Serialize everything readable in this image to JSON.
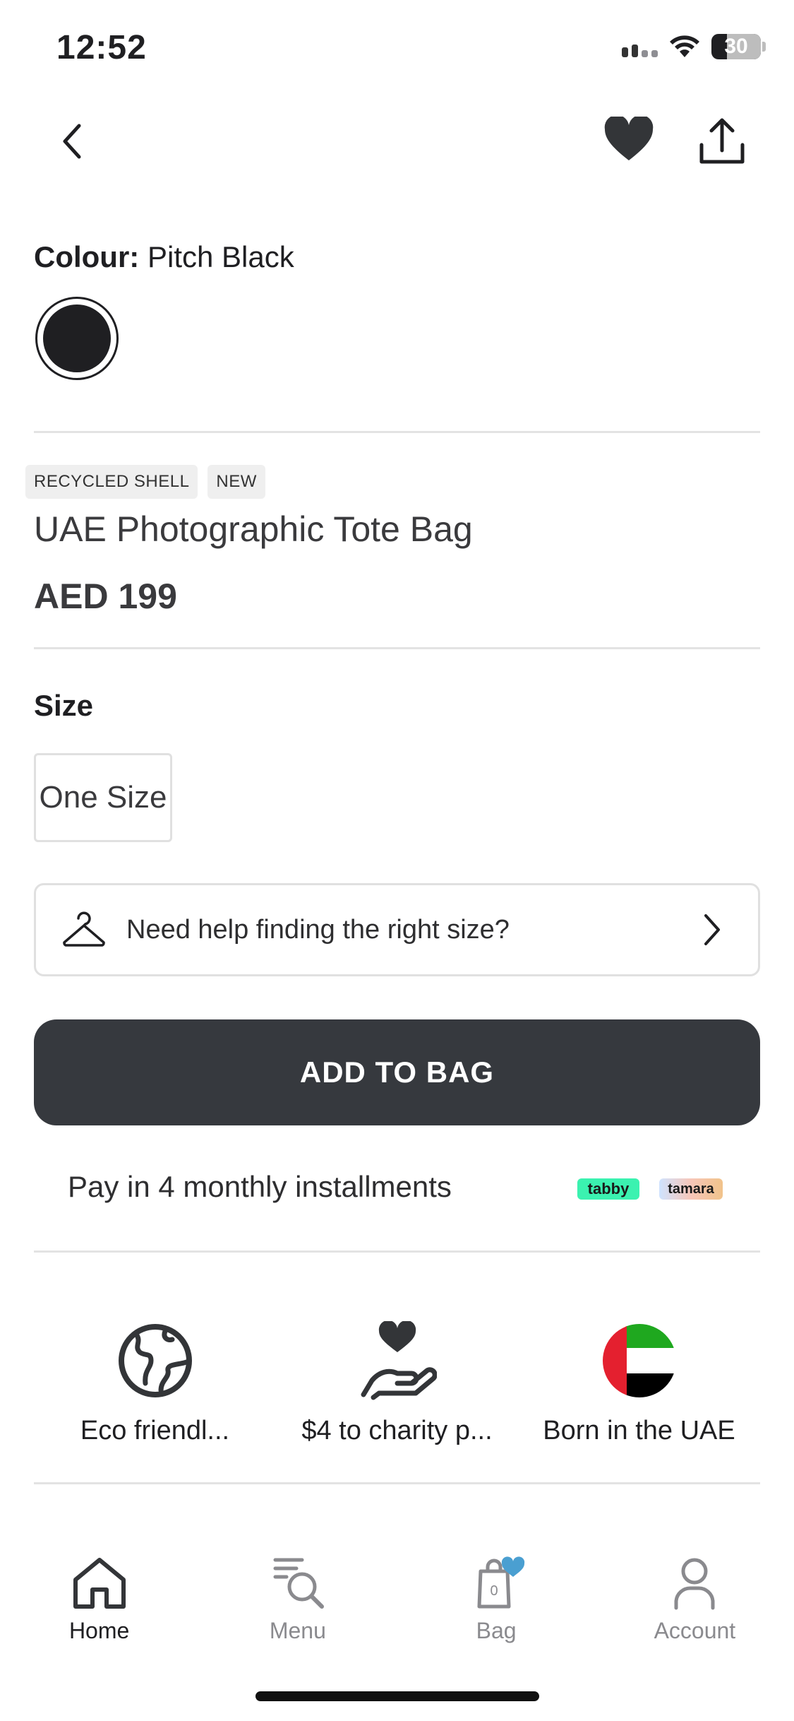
{
  "status_bar": {
    "time": "12:52",
    "battery": "30"
  },
  "product": {
    "colour_label": "Colour:",
    "colour_value": "Pitch Black",
    "swatch_color": "#1f1f22",
    "badges": [
      "RECYCLED SHELL",
      "NEW"
    ],
    "title": "UAE Photographic Tote Bag",
    "price": "AED 199"
  },
  "size": {
    "heading": "Size",
    "options": [
      "One Size"
    ]
  },
  "help": {
    "text": "Need help finding the right size?"
  },
  "add_to_bag": {
    "label": "ADD TO BAG",
    "color": "#36393e"
  },
  "installments": {
    "text": "Pay in 4 monthly installments",
    "providers": [
      "tabby",
      "tamara"
    ]
  },
  "features": [
    {
      "icon": "globe-icon",
      "label": "Eco friendl..."
    },
    {
      "icon": "charity-hand-heart-icon",
      "label": "$4 to charity p..."
    },
    {
      "icon": "uae-flag-icon",
      "label": "Born in the UAE"
    }
  ],
  "tabbar": {
    "items": [
      {
        "icon": "home-icon",
        "label": "Home",
        "active": true
      },
      {
        "icon": "menu-search-icon",
        "label": "Menu",
        "active": false
      },
      {
        "icon": "bag-icon",
        "label": "Bag",
        "active": false,
        "badge": "0"
      },
      {
        "icon": "account-icon",
        "label": "Account",
        "active": false
      }
    ]
  }
}
